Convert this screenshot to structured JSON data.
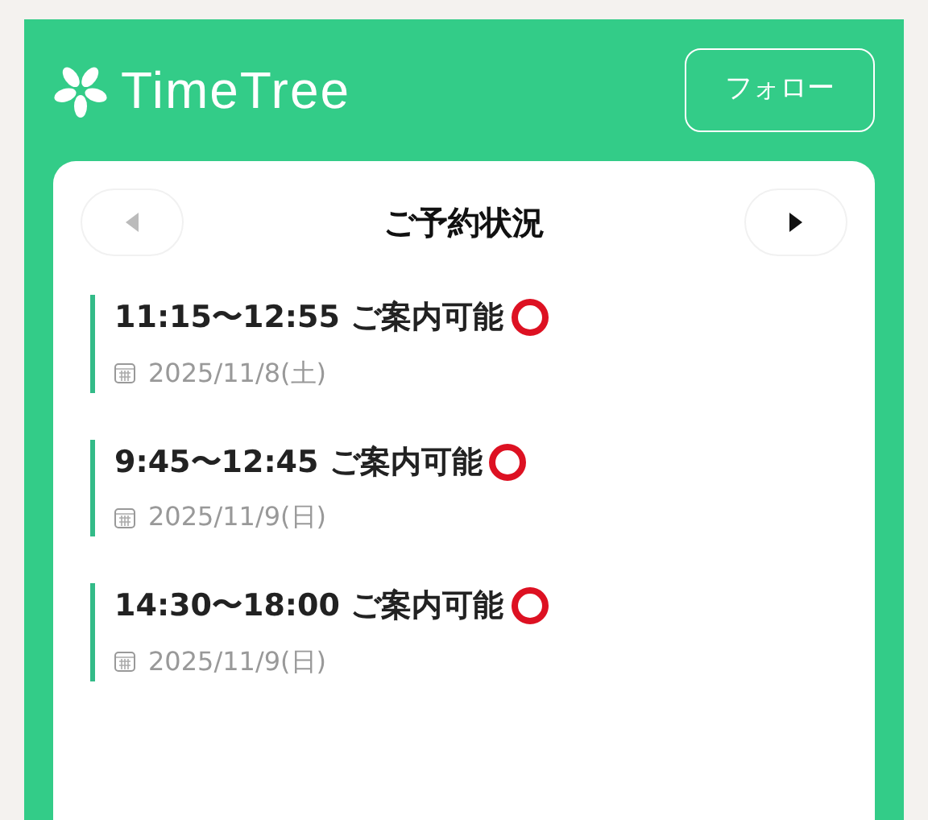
{
  "header": {
    "logo_text": "TimeTree",
    "follow_button": "フォロー"
  },
  "card": {
    "title": "ご予約状況",
    "prev_disabled": true,
    "next_disabled": false,
    "slots": [
      {
        "time": "11:15〜12:55 ご案内可能",
        "date": "2025/11/8(土)"
      },
      {
        "time": "9:45〜12:45 ご案内可能",
        "date": "2025/11/9(日)"
      },
      {
        "time": "14:30〜18:00 ご案内可能",
        "date": "2025/11/9(日)"
      }
    ]
  }
}
